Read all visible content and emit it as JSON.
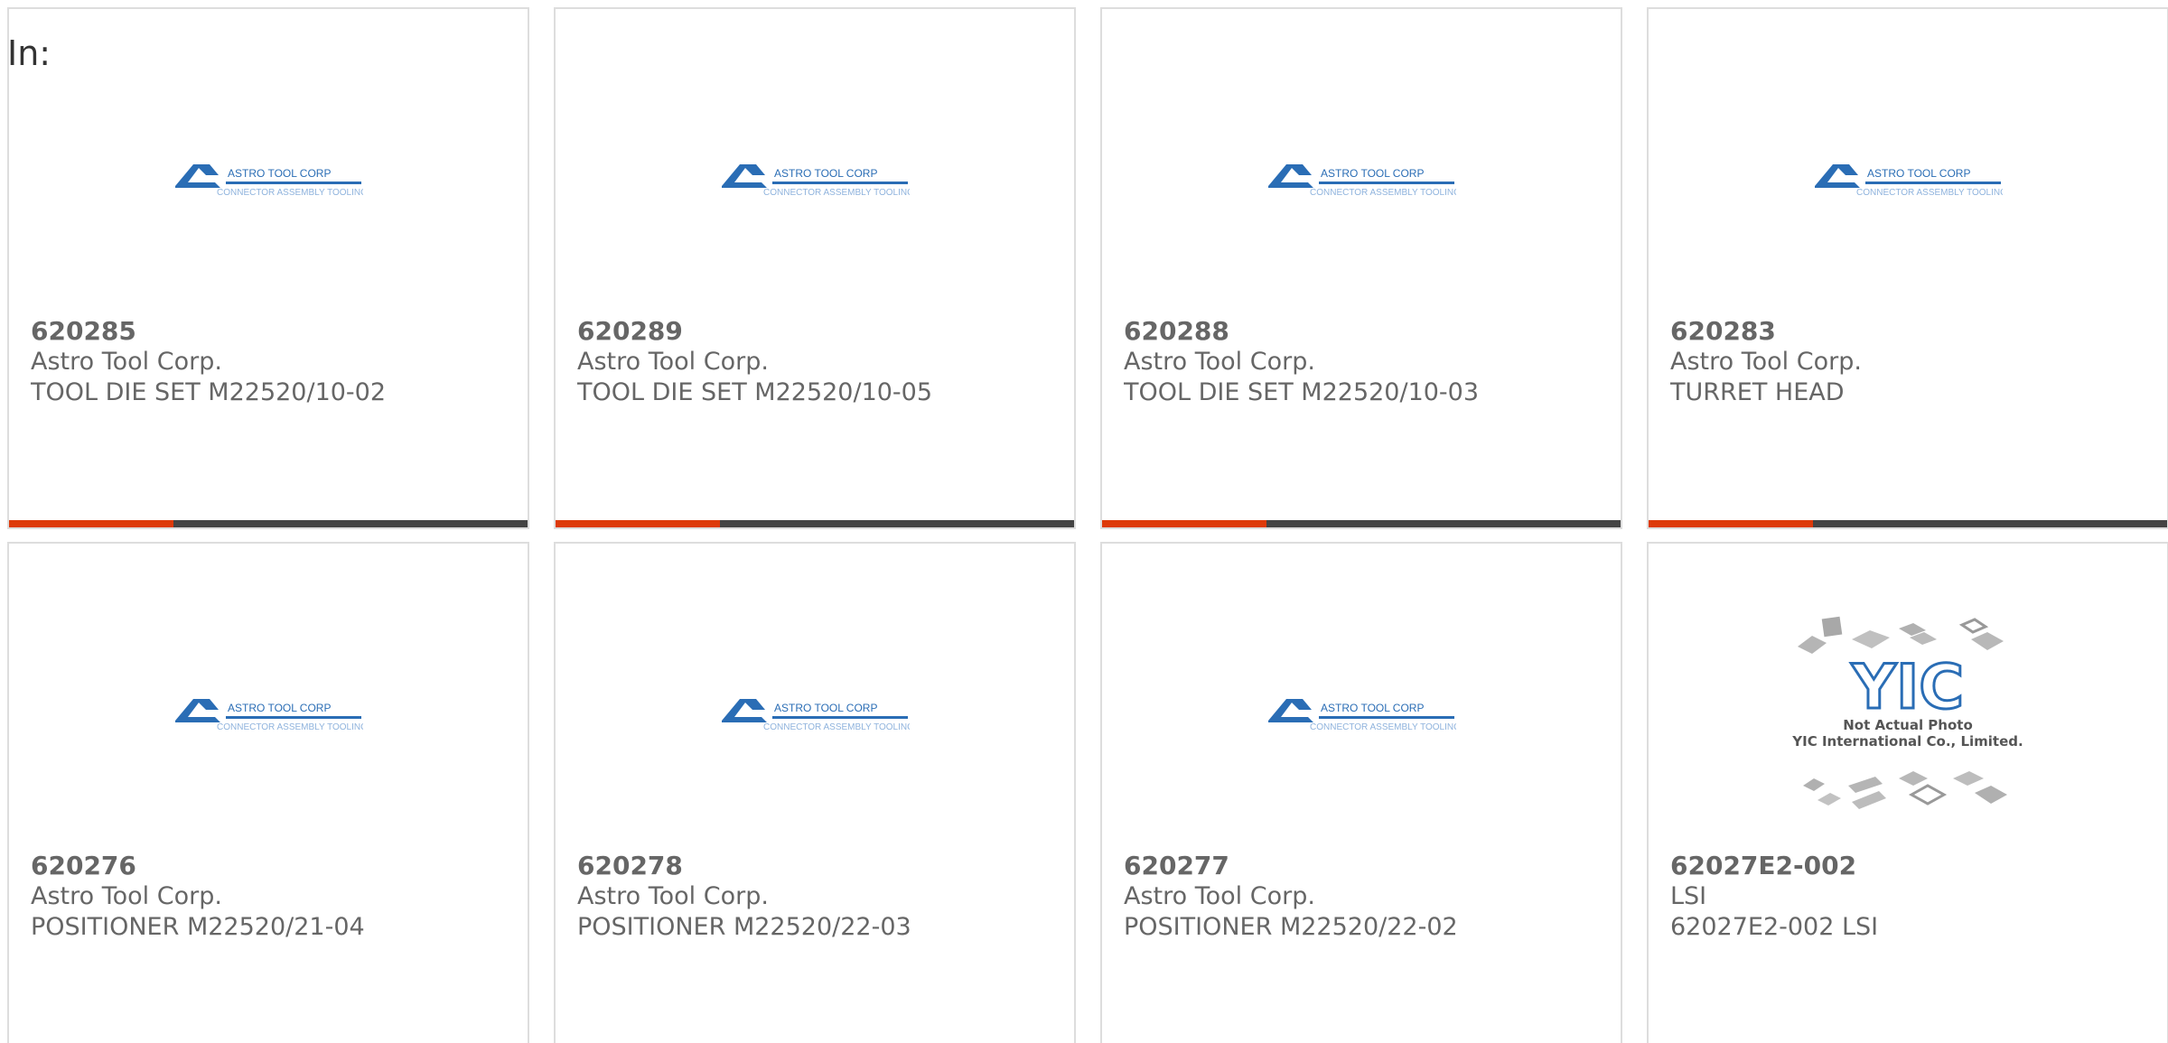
{
  "header": {
    "in_label": "In:"
  },
  "colors": {
    "accent": "#dd3a0a",
    "bar": "#444444",
    "brand_blue": "#2a6db5"
  },
  "logos": {
    "astro_line1": "ASTRO TOOL CORP",
    "astro_line2": "CONNECTOR ASSEMBLY TOOLING",
    "yic_mark": "YIC",
    "yic_note": "Not Actual Photo",
    "yic_company": "YIC International Co., Limited."
  },
  "products": [
    {
      "part": "620285",
      "maker": "Astro Tool Corp.",
      "desc": "TOOL DIE SET M22520/10-02",
      "image": "astro-logo",
      "bar": true
    },
    {
      "part": "620289",
      "maker": "Astro Tool Corp.",
      "desc": "TOOL DIE SET M22520/10-05",
      "image": "astro-logo",
      "bar": true
    },
    {
      "part": "620288",
      "maker": "Astro Tool Corp.",
      "desc": "TOOL DIE SET M22520/10-03",
      "image": "astro-logo",
      "bar": true
    },
    {
      "part": "620283",
      "maker": "Astro Tool Corp.",
      "desc": "TURRET HEAD",
      "image": "astro-logo",
      "bar": true
    },
    {
      "part": "620276",
      "maker": "Astro Tool Corp.",
      "desc": "POSITIONER M22520/21-04",
      "image": "astro-logo",
      "bar": false
    },
    {
      "part": "620278",
      "maker": "Astro Tool Corp.",
      "desc": "POSITIONER M22520/22-03",
      "image": "astro-logo",
      "bar": false
    },
    {
      "part": "620277",
      "maker": "Astro Tool Corp.",
      "desc": "POSITIONER M22520/22-02",
      "image": "astro-logo",
      "bar": false
    },
    {
      "part": "62027E2-002",
      "maker": "LSI",
      "desc": "62027E2-002 LSI",
      "image": "yic-placeholder",
      "bar": false
    }
  ]
}
